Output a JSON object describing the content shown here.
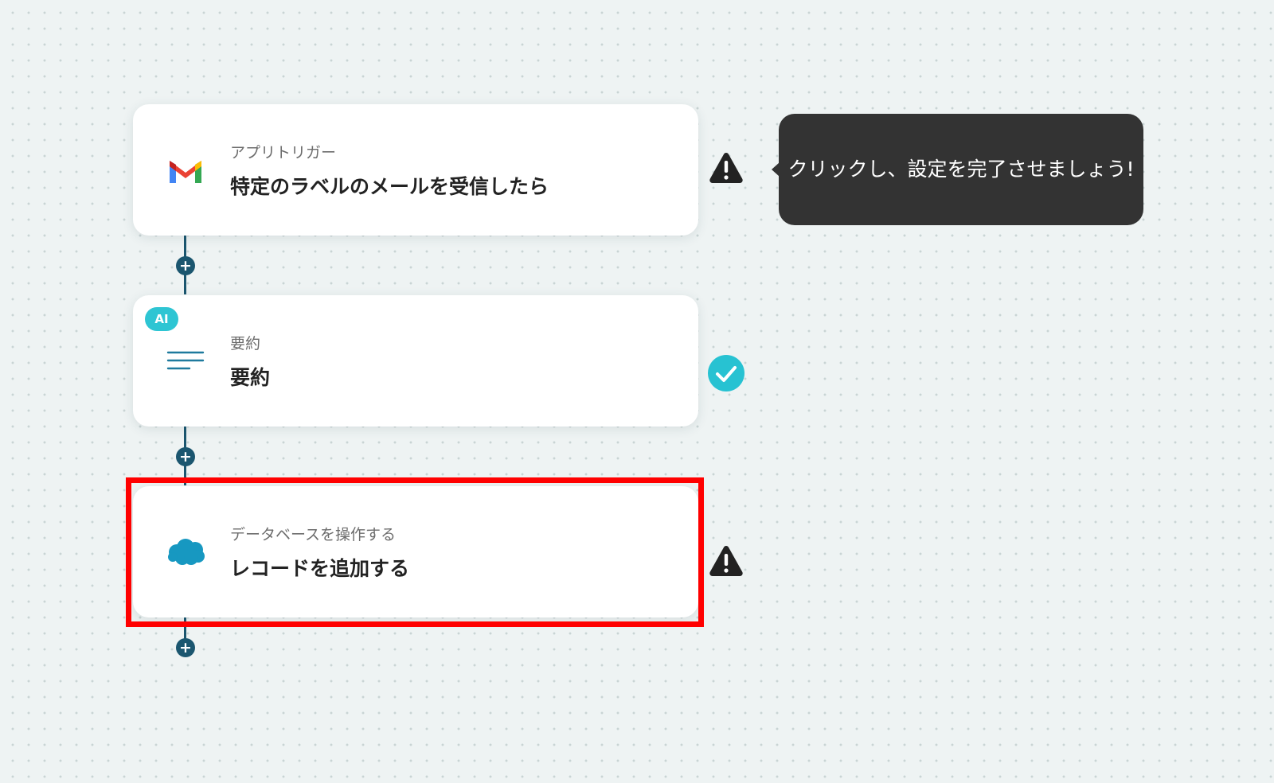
{
  "flow": {
    "steps": [
      {
        "subtitle": "アプリトリガー",
        "title": "特定のラベルのメールを受信したら",
        "icon": "gmail-icon",
        "status": "warning"
      },
      {
        "badge": "AI",
        "subtitle": "要約",
        "title": "要約",
        "icon": "summary-lines-icon",
        "status": "complete"
      },
      {
        "subtitle": "データベースを操作する",
        "title": "レコードを追加する",
        "icon": "salesforce-cloud-icon",
        "status": "warning",
        "highlighted": true
      }
    ],
    "add_step_symbol": "+"
  },
  "tooltip": {
    "text": "クリックし、設定を完了させましょう!"
  },
  "colors": {
    "connector": "#1b566f",
    "ai_badge": "#2ec5d3",
    "complete": "#27c2d2",
    "warning": "#222222",
    "highlight": "#ff0000",
    "tooltip_bg": "#333333"
  }
}
